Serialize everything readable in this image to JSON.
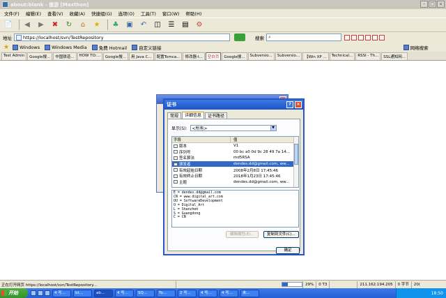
{
  "window": {
    "title": "about:blank - 傲游 [Maxthon]",
    "buttons": [
      "-",
      "□",
      "×"
    ]
  },
  "menu": [
    "文件(F)",
    "编辑(E)",
    "查看(V)",
    "收藏(A)",
    "快捷组(G)",
    "选项(O)",
    "工具(T)",
    "窗口(W)",
    "帮助(H)"
  ],
  "address": {
    "label": "地址",
    "url": "https://localhost/svn/TestRepository",
    "search_label": "搜索",
    "search_placeholder": ""
  },
  "links": [
    {
      "label": "Windows"
    },
    {
      "label": "Windows Media"
    },
    {
      "label": "免费 Hotmail"
    },
    {
      "label": "自定义链接"
    },
    {
      "label": "网络搜索"
    }
  ],
  "tabs": [
    "Test Admin",
    "Google搜...",
    "中国铁道...",
    "HOW TO:...",
    "Google搜...",
    "用 Java C...",
    "配置Tomca...",
    "修改器-I...",
    "空白页",
    "Google搜...",
    "Subversio...",
    "Subversio...",
    "【Win XP ...",
    "Technical...",
    "RSSI - Th...",
    "SSL通知网..."
  ],
  "active_tab_index": 8,
  "dialog": {
    "title": "证书",
    "help": "?",
    "close": "×",
    "tabs": [
      "常规",
      "详细信息",
      "证书路径"
    ],
    "active_tab": 1,
    "show_label": "显示(S):",
    "show_value": "<所有>",
    "list_header": {
      "field": "字段",
      "value": "值"
    },
    "rows": [
      {
        "field": "版本",
        "value": "V1",
        "selected": false
      },
      {
        "field": "序列号",
        "value": "00 bc a0 0d 9c 28 49 7a 14...",
        "selected": false
      },
      {
        "field": "签名算法",
        "value": "md5RSA",
        "selected": false
      },
      {
        "field": "颁发者",
        "value": "dendes.dd@gmail.com, ww...",
        "selected": true
      },
      {
        "field": "有效起始日期",
        "value": "2008年2月8日 17:45:46",
        "selected": false
      },
      {
        "field": "有效终止日期",
        "value": "2018年1月23日 17:45:46",
        "selected": false
      },
      {
        "field": "主题",
        "value": "dendes.dd@gmail.com, ww...",
        "selected": false
      }
    ],
    "detail_lines": [
      "E = dendes.dd@gmail.com",
      "CN = www.digital_art.com",
      "OU = SoftwareDevelopment",
      "O = Digital_Art",
      "L = Shanzhen",
      "S = Guangdong",
      "C = CN"
    ],
    "edit_props_button": "编辑属性(E)...",
    "copy_to_file_button": "复制到文件(C)...",
    "ok_button": "确定"
  },
  "status": {
    "text": "正在打开网页 https://localhost/svn/TestRepository...",
    "progress_percent": 29,
    "progress_label": "29%",
    "time_label": "0 T3",
    "ip": "211.162.194.205",
    "rate": "0 字节",
    "zoom": "20("
  },
  "taskbar": {
    "start": "开始",
    "tasks": [
      "4 写...",
      "bt...",
      "ab...",
      "4 写...",
      "SQ...",
      "To...",
      "2 写...",
      "4 写...",
      "4 写...",
      "未..."
    ],
    "active_task_index": 2,
    "clock": "18:50"
  }
}
